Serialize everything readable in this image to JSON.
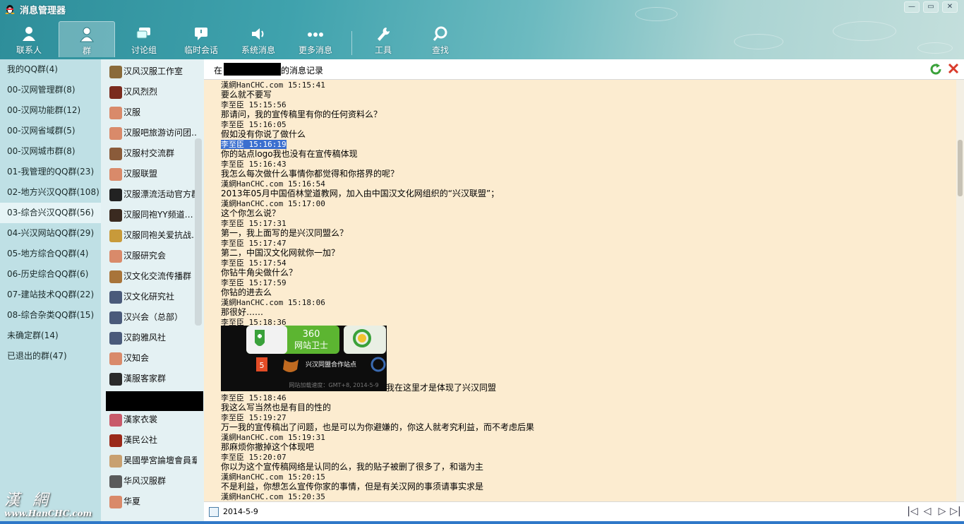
{
  "window": {
    "title": "消息管理器",
    "minimize": "—",
    "maximize": "▭",
    "close": "✕"
  },
  "nav": [
    {
      "label": "联系人",
      "icon": "contact-icon"
    },
    {
      "label": "群",
      "icon": "group-icon",
      "active": true
    },
    {
      "label": "讨论组",
      "icon": "discussion-icon"
    },
    {
      "label": "临时会话",
      "icon": "temp-chat-icon"
    },
    {
      "label": "系统消息",
      "icon": "system-message-icon"
    },
    {
      "label": "更多消息",
      "icon": "more-icon"
    },
    {
      "label": "工具",
      "icon": "wrench-icon"
    },
    {
      "label": "查找",
      "icon": "search-icon"
    }
  ],
  "folders": [
    {
      "label": "我的QQ群(4)"
    },
    {
      "label": "00-汉网管理群(8)"
    },
    {
      "label": "00-汉网功能群(12)"
    },
    {
      "label": "00-汉网省域群(5)"
    },
    {
      "label": "00-汉网城市群(8)"
    },
    {
      "label": "01-我管理的QQ群(23)"
    },
    {
      "label": "02-地方兴汉QQ群(108)"
    },
    {
      "label": "03-综合兴汉QQ群(56)",
      "active": true
    },
    {
      "label": "04-兴汉网站QQ群(29)"
    },
    {
      "label": "05-地方综合QQ群(4)"
    },
    {
      "label": "06-历史综合QQ群(6)"
    },
    {
      "label": "07-建站技术QQ群(22)"
    },
    {
      "label": "08-综合杂类QQ群(15)"
    },
    {
      "label": "未确定群(14)"
    },
    {
      "label": "已退出的群(47)"
    }
  ],
  "brand": {
    "chars": "漢網",
    "url": "www.HanCHC.com"
  },
  "groups": [
    {
      "name": "汉风汉服工作室",
      "color": "#8a6a3a"
    },
    {
      "name": "汉风烈烈",
      "color": "#7a2b1e"
    },
    {
      "name": "汉服",
      "color": "#d98a6a"
    },
    {
      "name": "汉服吧旅游访问团…",
      "color": "#d98a6a"
    },
    {
      "name": "汉服村交流群",
      "color": "#8a5b3a"
    },
    {
      "name": "汉服联盟",
      "color": "#d98a6a"
    },
    {
      "name": "汉服漂流活动官方群",
      "color": "#222222"
    },
    {
      "name": "汉服同袍YY频道招…",
      "color": "#3a2a20"
    },
    {
      "name": "汉服同袍关爱抗战…",
      "color": "#c89a3a"
    },
    {
      "name": "汉服研究会",
      "color": "#d98a6a"
    },
    {
      "name": "汉文化交流传播群",
      "color": "#a8743a"
    },
    {
      "name": "汉文化研究社",
      "color": "#4a5a7a"
    },
    {
      "name": "汉兴会（总部）",
      "color": "#4a5a7a"
    },
    {
      "name": "汉韵雅风社",
      "color": "#4a5a7a"
    },
    {
      "name": "汉知会",
      "color": "#d98a6a"
    },
    {
      "name": "漢服客家群",
      "color": "#2a2a2a"
    },
    {
      "name": "",
      "color": "#000000"
    },
    {
      "name": "漢家衣裳",
      "color": "#c85a6a"
    },
    {
      "name": "漢民公社",
      "color": "#9a2a1a"
    },
    {
      "name": "昊國學宮論壇會員羣",
      "color": "#c8a070"
    },
    {
      "name": "华风汉服群",
      "color": "#5a5a5a"
    },
    {
      "name": "华夏",
      "color": "#d98a6a"
    }
  ],
  "header": {
    "prefix": "在",
    "suffix": "的消息记录"
  },
  "messages": [
    {
      "meta": "漢網HanCHC.com 15:15:41"
    },
    {
      "text": "要么就不要写"
    },
    {
      "meta": "李至臣 15:15:56"
    },
    {
      "text": "那请问，我的宣传稿里有你的任何资料么？"
    },
    {
      "meta": "李至臣 15:16:05"
    },
    {
      "text": "假如没有你说了做什么"
    },
    {
      "meta": "李至臣 15:16:19",
      "selected": true
    },
    {
      "text": "你的站点logo我也没有在宣传稿体现"
    },
    {
      "meta": "李至臣 15:16:43"
    },
    {
      "text": "我怎么每次做什么事情你都觉得和你搭界的呢？"
    },
    {
      "meta": "漢網HanCHC.com 15:16:54"
    },
    {
      "text": "2013年05月中国佰林堂道教网，加入由中国汉文化网组织的“兴汉联盟”；"
    },
    {
      "meta": "漢網HanCHC.com 15:17:00"
    },
    {
      "text": "这个你怎么说？"
    },
    {
      "meta": "李至臣 15:17:31"
    },
    {
      "text": "第一，我上面写的是兴汉同盟么？"
    },
    {
      "meta": "李至臣 15:17:47"
    },
    {
      "text": "第二，中国汉文化网就你一加？"
    },
    {
      "meta": "李至臣 15:17:54"
    },
    {
      "text": "你钻牛角尖做什么？"
    },
    {
      "meta": "李至臣 15:17:59"
    },
    {
      "text": "你钻的进去么"
    },
    {
      "meta": "漢網HanCHC.com 15:18:06"
    },
    {
      "text": "那很好……"
    },
    {
      "meta": "李至臣 15:18:36"
    }
  ],
  "image_caption": "我在这里才是体现了兴汉同盟",
  "shot": {
    "brand_num": "360",
    "brand_name": "网站卫士",
    "badge": "兴汉同盟合作站点",
    "footer": "网站加载速度：GMT+8, 2014-5-9"
  },
  "messages2": [
    {
      "meta": "李至臣 15:18:46"
    },
    {
      "text": "我这么写当然也是有目的性的"
    },
    {
      "meta": "李至臣 15:19:27"
    },
    {
      "text": "万一我的宣传稿出了问题，也是可以为你避嫌的，你这人就考究利益，而不考虑后果"
    },
    {
      "meta": "漢網HanCHC.com 15:19:31"
    },
    {
      "text": "那麻烦你撤掉这个体现吧"
    },
    {
      "meta": "李至臣 15:20:07"
    },
    {
      "text": "你以为这个宣传稿网络是认同的么，我的贴子被删了很多了，和谐为主"
    },
    {
      "meta": "漢網HanCHC.com 15:20:15"
    },
    {
      "text": "不是利益，你想怎么宣传你家的事情，但是有关汉网的事须请事实求是"
    },
    {
      "meta": "漢網HanCHC.com 15:20:35"
    }
  ],
  "footer": {
    "date": "2014-5-9",
    "first": "|◁",
    "prev": "◁",
    "next": "▷",
    "last": "▷|"
  },
  "colors": {
    "accent": "#3fa2ad",
    "log_bg": "#fcecd0",
    "selection": "#3b6fcf"
  }
}
